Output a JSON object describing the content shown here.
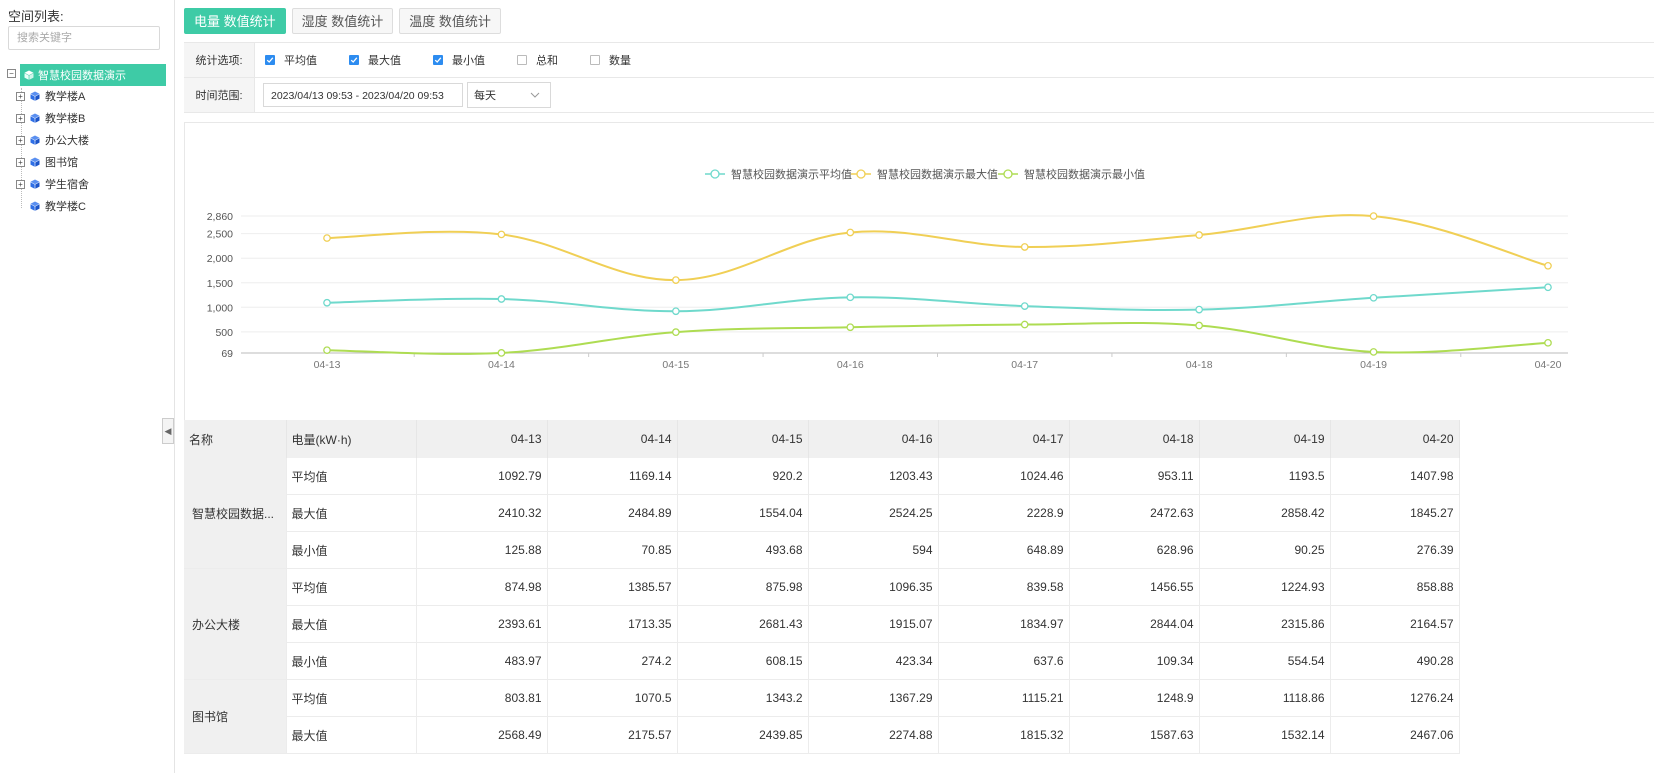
{
  "sidebar": {
    "title": "空间列表:",
    "search_placeholder": "搜索关键字",
    "root": {
      "label": "智慧校园数据演示",
      "toggle": "−"
    },
    "items": [
      {
        "label": "教学楼A",
        "toggle": "+"
      },
      {
        "label": "教学楼B",
        "toggle": "+"
      },
      {
        "label": "办公大楼",
        "toggle": "+"
      },
      {
        "label": "图书馆",
        "toggle": "+"
      },
      {
        "label": "学生宿舍",
        "toggle": "+"
      },
      {
        "label": "教学楼C",
        "toggle": ""
      }
    ],
    "collapse_glyph": "◀"
  },
  "tabs": [
    {
      "label": "电量 数值统计",
      "active": true
    },
    {
      "label": "湿度 数值统计",
      "active": false
    },
    {
      "label": "温度 数值统计",
      "active": false
    }
  ],
  "filters": {
    "stats_label": "统计选项:",
    "options": [
      {
        "label": "平均值",
        "checked": true
      },
      {
        "label": "最大值",
        "checked": true
      },
      {
        "label": "最小值",
        "checked": true
      },
      {
        "label": "总和",
        "checked": false
      },
      {
        "label": "数量",
        "checked": false
      }
    ],
    "time_label": "时间范围:",
    "date_range": "2023/04/13 09:53 - 2023/04/20 09:53",
    "interval": "每天"
  },
  "colors": {
    "accent": "#3ecba6",
    "avg": "#6fd9cc",
    "max": "#f0cf55",
    "min": "#aedc52",
    "check": "#2d8cf0"
  },
  "chart_data": {
    "type": "line",
    "categories": [
      "04-13",
      "04-14",
      "04-15",
      "04-16",
      "04-17",
      "04-18",
      "04-19",
      "04-20"
    ],
    "series": [
      {
        "name": "智慧校园数据演示平均值",
        "values": [
          1092.79,
          1169.14,
          920.2,
          1203.43,
          1024.46,
          953.11,
          1193.5,
          1407.98
        ]
      },
      {
        "name": "智慧校园数据演示最大值",
        "values": [
          2410.32,
          2484.89,
          1554.04,
          2524.25,
          2228.9,
          2472.63,
          2858.42,
          1845.27
        ]
      },
      {
        "name": "智慧校园数据演示最小值",
        "values": [
          125.88,
          70.85,
          493.68,
          594,
          648.89,
          628.96,
          90.25,
          276.39
        ]
      }
    ],
    "yticks": [
      "2,860",
      "2,500",
      "2,000",
      "1,500",
      "1,000",
      "500",
      "69"
    ],
    "ylim": [
      69,
      2860
    ],
    "legend": "top-center",
    "grid": true
  },
  "table": {
    "header_name": "名称",
    "header_unit": "电量(kW·h)",
    "dates": [
      "04-13",
      "04-14",
      "04-15",
      "04-16",
      "04-17",
      "04-18",
      "04-19",
      "04-20"
    ],
    "groups": [
      {
        "name": "智慧校园数据...",
        "rows": [
          {
            "metric": "平均值",
            "values": [
              "1092.79",
              "1169.14",
              "920.2",
              "1203.43",
              "1024.46",
              "953.11",
              "1193.5",
              "1407.98"
            ]
          },
          {
            "metric": "最大值",
            "values": [
              "2410.32",
              "2484.89",
              "1554.04",
              "2524.25",
              "2228.9",
              "2472.63",
              "2858.42",
              "1845.27"
            ]
          },
          {
            "metric": "最小值",
            "values": [
              "125.88",
              "70.85",
              "493.68",
              "594",
              "648.89",
              "628.96",
              "90.25",
              "276.39"
            ]
          }
        ]
      },
      {
        "name": "办公大楼",
        "rows": [
          {
            "metric": "平均值",
            "values": [
              "874.98",
              "1385.57",
              "875.98",
              "1096.35",
              "839.58",
              "1456.55",
              "1224.93",
              "858.88"
            ]
          },
          {
            "metric": "最大值",
            "values": [
              "2393.61",
              "1713.35",
              "2681.43",
              "1915.07",
              "1834.97",
              "2844.04",
              "2315.86",
              "2164.57"
            ]
          },
          {
            "metric": "最小值",
            "values": [
              "483.97",
              "274.2",
              "608.15",
              "423.34",
              "637.6",
              "109.34",
              "554.54",
              "490.28"
            ]
          }
        ]
      },
      {
        "name": "图书馆",
        "rows": [
          {
            "metric": "平均值",
            "values": [
              "803.81",
              "1070.5",
              "1343.2",
              "1367.29",
              "1115.21",
              "1248.9",
              "1118.86",
              "1276.24"
            ]
          },
          {
            "metric": "最大值",
            "values": [
              "2568.49",
              "2175.57",
              "2439.85",
              "2274.88",
              "1815.32",
              "1587.63",
              "1532.14",
              "2467.06"
            ]
          }
        ]
      }
    ]
  }
}
